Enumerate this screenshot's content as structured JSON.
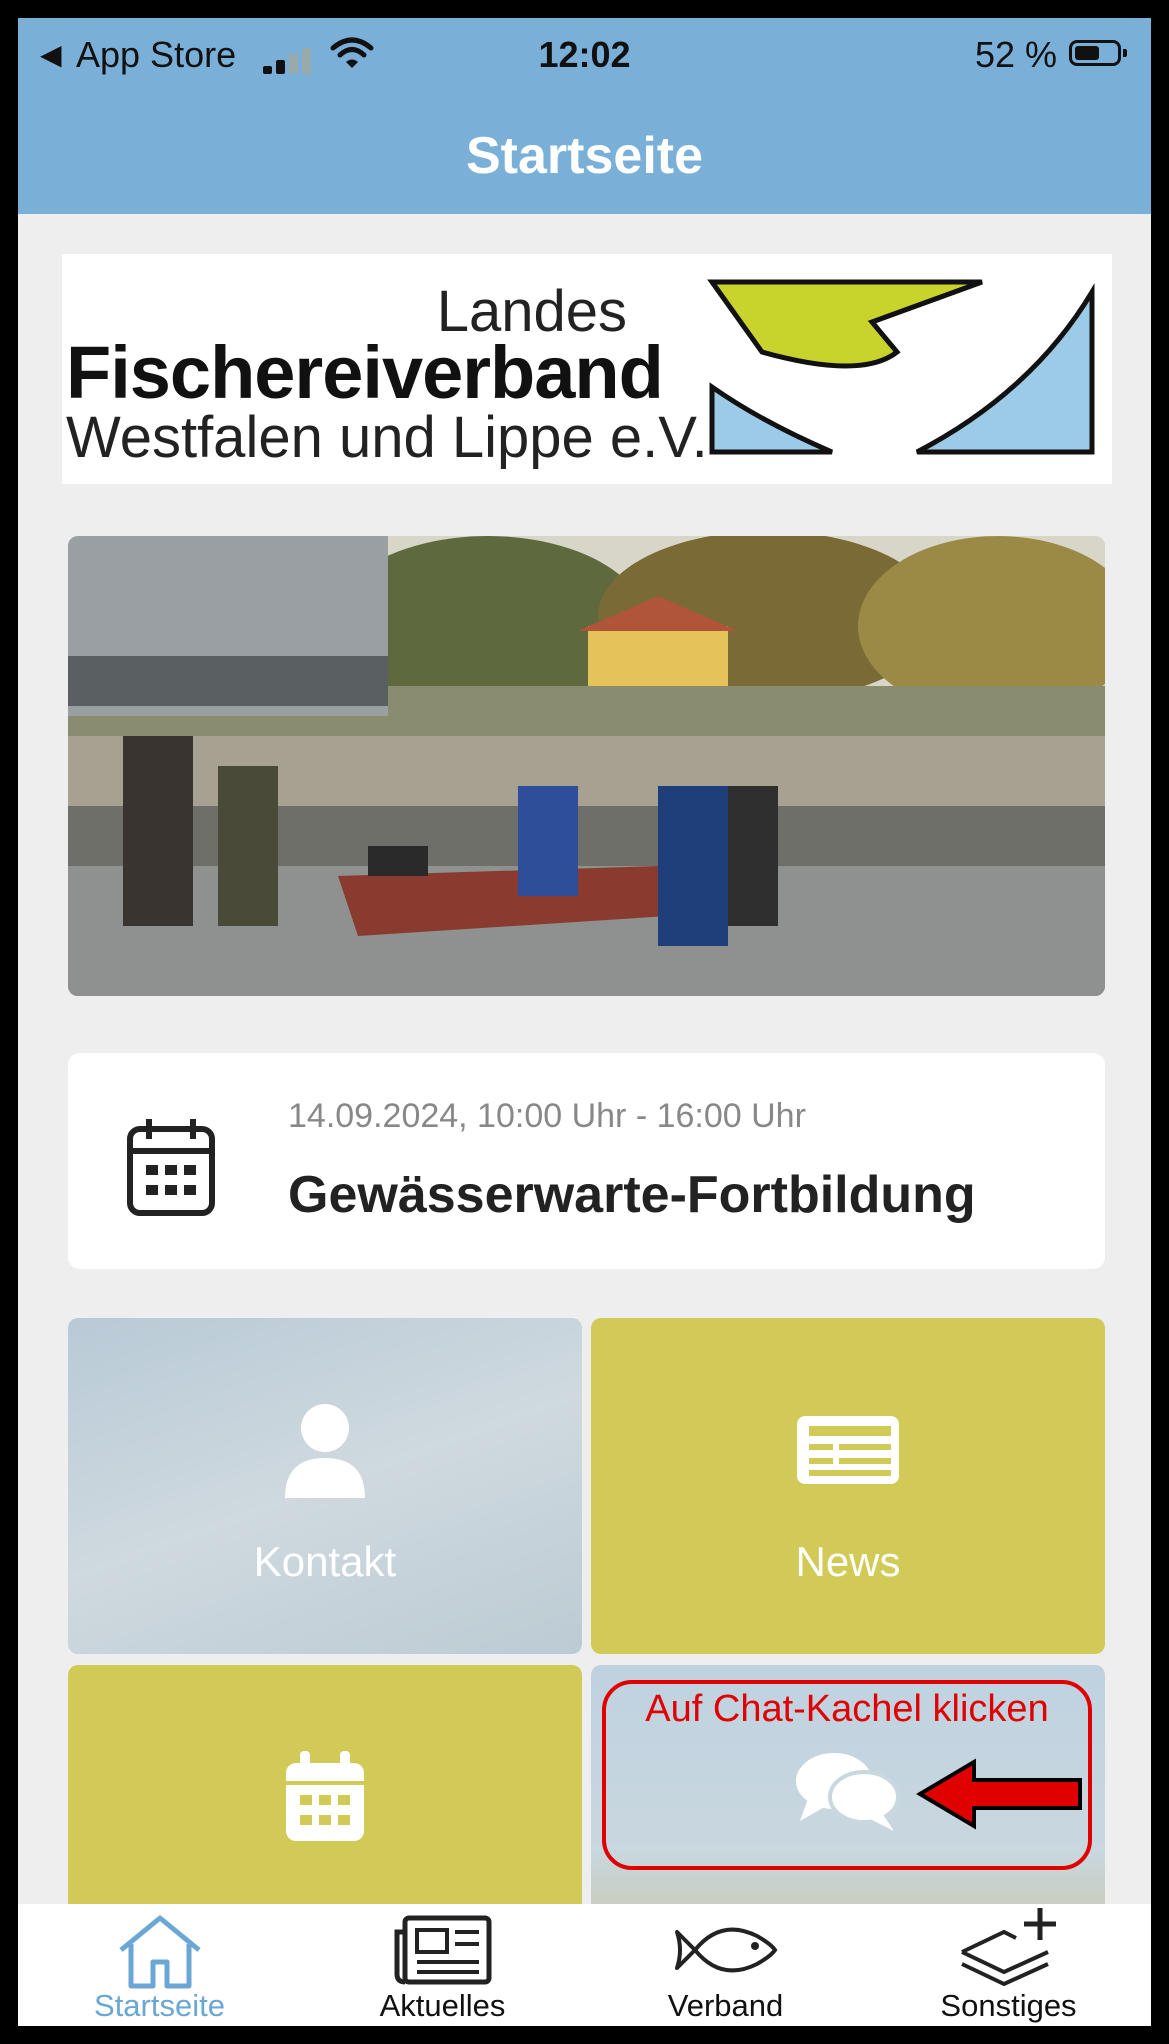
{
  "status_bar": {
    "back_label": "◀",
    "app_label": "App Store",
    "time": "12:02",
    "battery": "52 %"
  },
  "header": {
    "title": "Startseite"
  },
  "logo": {
    "line1": "Landes",
    "line2": "Fischereiverband",
    "line3": "Westfalen und Lippe e.V."
  },
  "event": {
    "date": "14.09.2024, 10:00 Uhr - 16:00 Uhr",
    "title": "Gewässerwarte-Fortbildung"
  },
  "tiles": [
    {
      "label": "Kontakt",
      "icon": "person-icon"
    },
    {
      "label": "News",
      "icon": "newspaper-icon"
    },
    {
      "label": "",
      "icon": "calendar-icon"
    },
    {
      "label": "",
      "icon": "chat-icon"
    }
  ],
  "annotation": {
    "text": "Auf Chat-Kachel klicken"
  },
  "tabbar": {
    "items": [
      {
        "label": "Startseite",
        "icon": "home-icon",
        "active": true
      },
      {
        "label": "Aktuelles",
        "icon": "newspaper-icon"
      },
      {
        "label": "Verband",
        "icon": "fish-icon"
      },
      {
        "label": "Sonstiges",
        "icon": "layers-plus-icon"
      }
    ]
  },
  "colors": {
    "header": "#7ab0d8",
    "tile_yellow": "#d2ca56",
    "annotation": "#e00000",
    "tab_active": "#6aa7d4"
  }
}
